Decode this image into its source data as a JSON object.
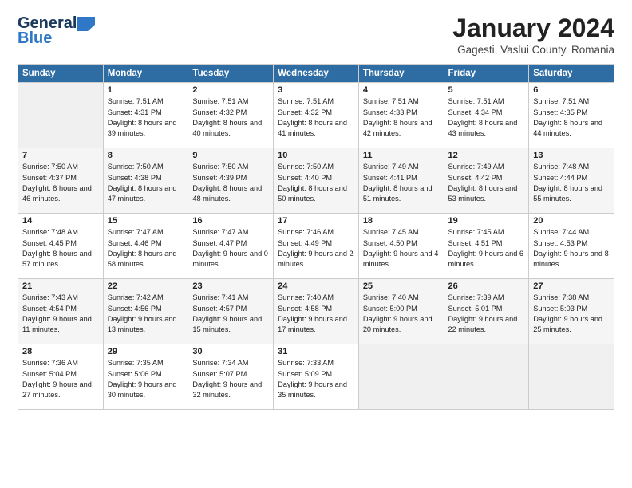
{
  "logo": {
    "line1": "General",
    "line2": "Blue"
  },
  "title": "January 2024",
  "subtitle": "Gagesti, Vaslui County, Romania",
  "days_header": [
    "Sunday",
    "Monday",
    "Tuesday",
    "Wednesday",
    "Thursday",
    "Friday",
    "Saturday"
  ],
  "weeks": [
    [
      {
        "num": "",
        "info": ""
      },
      {
        "num": "1",
        "info": "Sunrise: 7:51 AM\nSunset: 4:31 PM\nDaylight: 8 hours\nand 39 minutes."
      },
      {
        "num": "2",
        "info": "Sunrise: 7:51 AM\nSunset: 4:32 PM\nDaylight: 8 hours\nand 40 minutes."
      },
      {
        "num": "3",
        "info": "Sunrise: 7:51 AM\nSunset: 4:32 PM\nDaylight: 8 hours\nand 41 minutes."
      },
      {
        "num": "4",
        "info": "Sunrise: 7:51 AM\nSunset: 4:33 PM\nDaylight: 8 hours\nand 42 minutes."
      },
      {
        "num": "5",
        "info": "Sunrise: 7:51 AM\nSunset: 4:34 PM\nDaylight: 8 hours\nand 43 minutes."
      },
      {
        "num": "6",
        "info": "Sunrise: 7:51 AM\nSunset: 4:35 PM\nDaylight: 8 hours\nand 44 minutes."
      }
    ],
    [
      {
        "num": "7",
        "info": "Sunrise: 7:50 AM\nSunset: 4:37 PM\nDaylight: 8 hours\nand 46 minutes."
      },
      {
        "num": "8",
        "info": "Sunrise: 7:50 AM\nSunset: 4:38 PM\nDaylight: 8 hours\nand 47 minutes."
      },
      {
        "num": "9",
        "info": "Sunrise: 7:50 AM\nSunset: 4:39 PM\nDaylight: 8 hours\nand 48 minutes."
      },
      {
        "num": "10",
        "info": "Sunrise: 7:50 AM\nSunset: 4:40 PM\nDaylight: 8 hours\nand 50 minutes."
      },
      {
        "num": "11",
        "info": "Sunrise: 7:49 AM\nSunset: 4:41 PM\nDaylight: 8 hours\nand 51 minutes."
      },
      {
        "num": "12",
        "info": "Sunrise: 7:49 AM\nSunset: 4:42 PM\nDaylight: 8 hours\nand 53 minutes."
      },
      {
        "num": "13",
        "info": "Sunrise: 7:48 AM\nSunset: 4:44 PM\nDaylight: 8 hours\nand 55 minutes."
      }
    ],
    [
      {
        "num": "14",
        "info": "Sunrise: 7:48 AM\nSunset: 4:45 PM\nDaylight: 8 hours\nand 57 minutes."
      },
      {
        "num": "15",
        "info": "Sunrise: 7:47 AM\nSunset: 4:46 PM\nDaylight: 8 hours\nand 58 minutes."
      },
      {
        "num": "16",
        "info": "Sunrise: 7:47 AM\nSunset: 4:47 PM\nDaylight: 9 hours\nand 0 minutes."
      },
      {
        "num": "17",
        "info": "Sunrise: 7:46 AM\nSunset: 4:49 PM\nDaylight: 9 hours\nand 2 minutes."
      },
      {
        "num": "18",
        "info": "Sunrise: 7:45 AM\nSunset: 4:50 PM\nDaylight: 9 hours\nand 4 minutes."
      },
      {
        "num": "19",
        "info": "Sunrise: 7:45 AM\nSunset: 4:51 PM\nDaylight: 9 hours\nand 6 minutes."
      },
      {
        "num": "20",
        "info": "Sunrise: 7:44 AM\nSunset: 4:53 PM\nDaylight: 9 hours\nand 8 minutes."
      }
    ],
    [
      {
        "num": "21",
        "info": "Sunrise: 7:43 AM\nSunset: 4:54 PM\nDaylight: 9 hours\nand 11 minutes."
      },
      {
        "num": "22",
        "info": "Sunrise: 7:42 AM\nSunset: 4:56 PM\nDaylight: 9 hours\nand 13 minutes."
      },
      {
        "num": "23",
        "info": "Sunrise: 7:41 AM\nSunset: 4:57 PM\nDaylight: 9 hours\nand 15 minutes."
      },
      {
        "num": "24",
        "info": "Sunrise: 7:40 AM\nSunset: 4:58 PM\nDaylight: 9 hours\nand 17 minutes."
      },
      {
        "num": "25",
        "info": "Sunrise: 7:40 AM\nSunset: 5:00 PM\nDaylight: 9 hours\nand 20 minutes."
      },
      {
        "num": "26",
        "info": "Sunrise: 7:39 AM\nSunset: 5:01 PM\nDaylight: 9 hours\nand 22 minutes."
      },
      {
        "num": "27",
        "info": "Sunrise: 7:38 AM\nSunset: 5:03 PM\nDaylight: 9 hours\nand 25 minutes."
      }
    ],
    [
      {
        "num": "28",
        "info": "Sunrise: 7:36 AM\nSunset: 5:04 PM\nDaylight: 9 hours\nand 27 minutes."
      },
      {
        "num": "29",
        "info": "Sunrise: 7:35 AM\nSunset: 5:06 PM\nDaylight: 9 hours\nand 30 minutes."
      },
      {
        "num": "30",
        "info": "Sunrise: 7:34 AM\nSunset: 5:07 PM\nDaylight: 9 hours\nand 32 minutes."
      },
      {
        "num": "31",
        "info": "Sunrise: 7:33 AM\nSunset: 5:09 PM\nDaylight: 9 hours\nand 35 minutes."
      },
      {
        "num": "",
        "info": ""
      },
      {
        "num": "",
        "info": ""
      },
      {
        "num": "",
        "info": ""
      }
    ]
  ]
}
